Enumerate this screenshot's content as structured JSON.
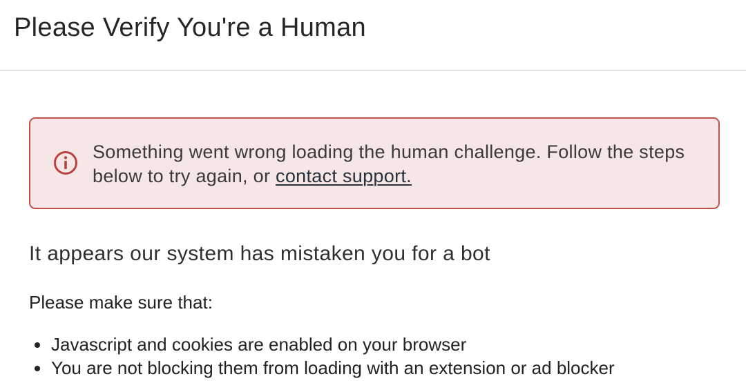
{
  "header": {
    "title": "Please Verify You're a Human"
  },
  "alert": {
    "icon": "info-circle-icon",
    "message": "Something went wrong loading the human challenge. Follow the steps below to try again, or ",
    "link_text": "contact support.",
    "colors": {
      "background": "#f6e6e6",
      "border": "#c1504a",
      "icon": "#b8433e"
    }
  },
  "content": {
    "heading": "It appears our system has mistaken you for a bot",
    "intro": "Please make sure that:",
    "requirements": [
      "Javascript and cookies are enabled on your browser",
      "You are not blocking them from loading with an extension or ad blocker"
    ]
  }
}
